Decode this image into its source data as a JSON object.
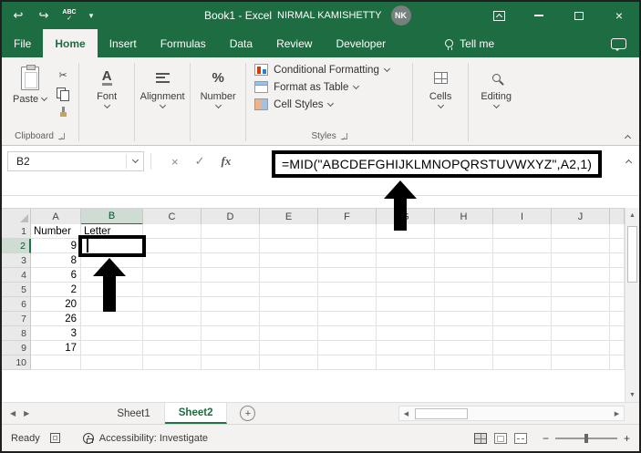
{
  "colors": {
    "title_bar_green": "#1E6C41",
    "accent_green": "#217346",
    "ribbon_bg": "#F3F2F1",
    "annotation_black": "#000000"
  },
  "title_bar": {
    "window_title": "Book1  -  Excel",
    "user_name": "NIRMAL KAMISHETTY",
    "avatar_initials": "NK"
  },
  "ribbon": {
    "tabs": [
      {
        "label": "File",
        "active": false
      },
      {
        "label": "Home",
        "active": true
      },
      {
        "label": "Insert",
        "active": false
      },
      {
        "label": "Formulas",
        "active": false
      },
      {
        "label": "Data",
        "active": false
      },
      {
        "label": "Review",
        "active": false
      },
      {
        "label": "Developer",
        "active": false
      }
    ],
    "tell_me_label": "Tell me",
    "clipboard": {
      "paste_label": "Paste",
      "group_label": "Clipboard"
    },
    "font_label": "Font",
    "alignment_label": "Alignment",
    "number_label": "Number",
    "styles": {
      "conditional_formatting": "Conditional Formatting",
      "format_as_table": "Format as Table",
      "cell_styles": "Cell Styles",
      "group_label": "Styles"
    },
    "cells_label": "Cells",
    "editing_label": "Editing"
  },
  "formula_bar": {
    "name_box_value": "B2",
    "fx_label": "fx",
    "formula": "=MID(\"ABCDEFGHIJKLMNOPQRSTUVWXYZ\",A2,1)"
  },
  "grid": {
    "columns": [
      "A",
      "B",
      "C",
      "D",
      "E",
      "F",
      "G",
      "H",
      "I",
      "J"
    ],
    "rows": [
      "1",
      "2",
      "3",
      "4",
      "5",
      "6",
      "7",
      "8",
      "9",
      "10"
    ],
    "cells": {
      "A1": "Number",
      "B1": "Letter",
      "A2": "9",
      "A3": "8",
      "A4": "6",
      "A5": "2",
      "A6": "20",
      "A7": "26",
      "A8": "3",
      "A9": "17"
    },
    "selected_cell": "B2",
    "selected_column": "B",
    "selected_row": "2"
  },
  "sheet_tabs": {
    "tabs": [
      {
        "label": "Sheet1",
        "active": false
      },
      {
        "label": "Sheet2",
        "active": true
      }
    ]
  },
  "status_bar": {
    "mode": "Ready",
    "accessibility": "Accessibility: Investigate"
  },
  "icons": {
    "undo": "↩",
    "redo": "↪",
    "spell_abc": "ABC",
    "check": "✓",
    "caret_down": "▾",
    "close": "×",
    "cancel": "×",
    "scissors": "✂",
    "font_a": "A",
    "percent": "%",
    "nav_left": "◀",
    "nav_right": "▶",
    "scroll_up": "▲",
    "scroll_down": "▼",
    "minus": "−",
    "plus": "+"
  }
}
